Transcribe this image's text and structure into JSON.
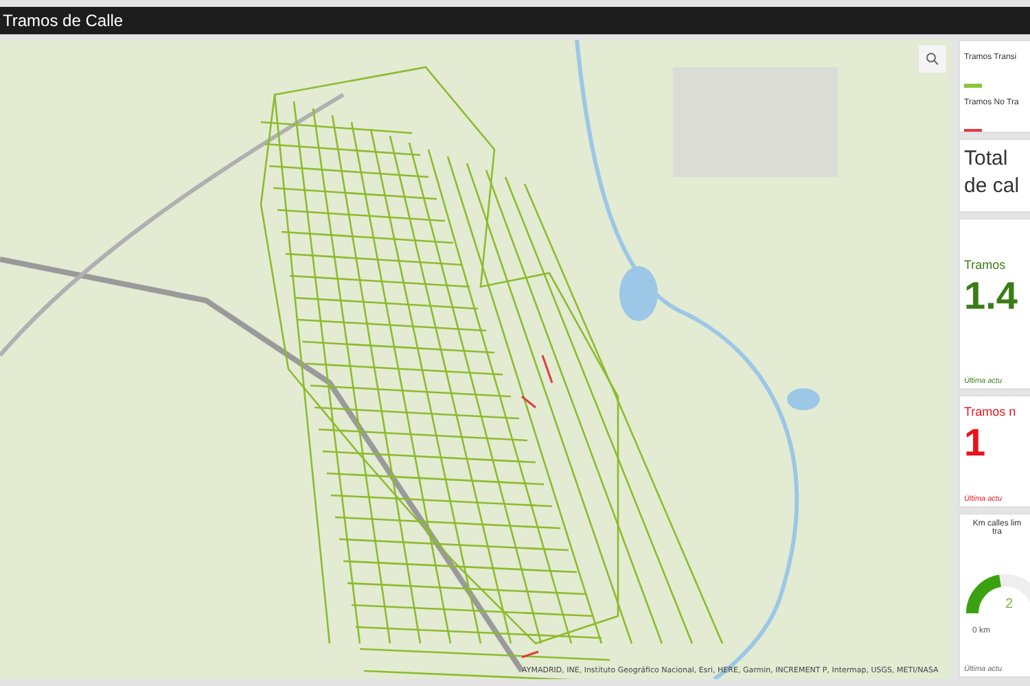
{
  "header": {
    "title": "Tramos de Calle"
  },
  "map": {
    "attribution": "AYMADRID, INE, Instituto Geográfico Nacional, Esri, HERE, Garmin, INCREMENT P, Intermap, USGS, METI/NASA"
  },
  "legend": {
    "items": [
      {
        "label": "Tramos Transi",
        "color": "#8cc63f"
      },
      {
        "label": "Tramos No Tra",
        "color": "#e0393e"
      }
    ]
  },
  "total_card": {
    "lines": [
      "Total",
      "de cal"
    ]
  },
  "indicators": [
    {
      "title": "Tramos",
      "value": "1.4",
      "footer": "Última actu",
      "color": "#3a7d17"
    },
    {
      "title": "Tramos n",
      "value": "1",
      "footer": "Última actu",
      "color": "#e8141c"
    }
  ],
  "gauge": {
    "title_lines": [
      "Km calles lim",
      "tra"
    ],
    "value": "2",
    "min_label": "0 km",
    "footer": "Última actu",
    "level": 0.45
  }
}
